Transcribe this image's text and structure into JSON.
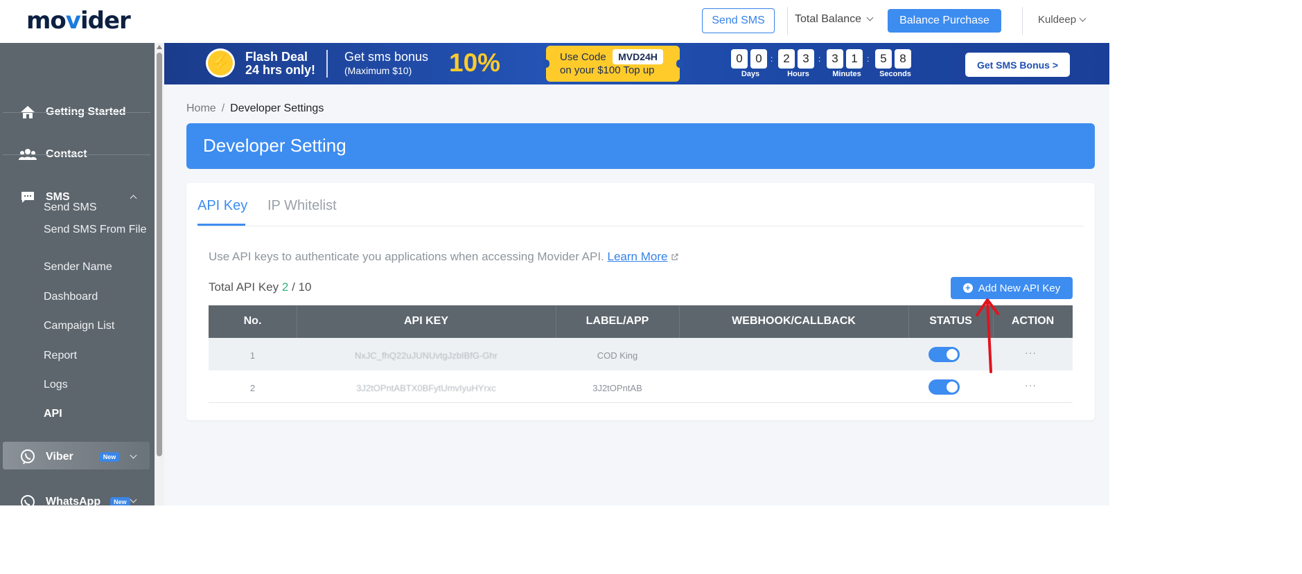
{
  "header": {
    "logo_text_a": "mo",
    "logo_text_v": "v",
    "logo_text_b": "ider",
    "send_sms": "Send SMS",
    "total_balance": "Total Balance",
    "balance_purchase": "Balance Purchase",
    "user": "Kuldeep"
  },
  "sidebar": {
    "items": [
      {
        "label": "Getting Started",
        "icon": "home-icon"
      },
      {
        "label": "Contact",
        "icon": "users-icon"
      },
      {
        "label": "SMS",
        "icon": "message-icon"
      },
      {
        "label": "Viber",
        "icon": "viber-icon",
        "badge": "New"
      },
      {
        "label": "WhatsApp",
        "icon": "whatsapp-icon",
        "badge": "New"
      }
    ],
    "sms_sub": [
      "Send SMS",
      "Send SMS From File",
      "Sender Name",
      "Dashboard",
      "Campaign List",
      "Report",
      "Logs",
      "API"
    ],
    "active": "API"
  },
  "banner": {
    "title_line1": "Flash Deal",
    "title_line2": "24 hrs only!",
    "bonus_line1": "Get sms bonus",
    "bonus_line2": "(Maximum $10)",
    "bonus_pct": "10%",
    "use_code": "Use Code",
    "code": "MVD24H",
    "code_note": "on your $100 Top up",
    "countdown": {
      "days": [
        "0",
        "0"
      ],
      "hours": [
        "2",
        "3"
      ],
      "minutes": [
        "3",
        "1"
      ],
      "seconds": [
        "5",
        "8"
      ],
      "labels": [
        "Days",
        "Hours",
        "Minutes",
        "Seconds"
      ]
    },
    "cta": "Get SMS Bonus >"
  },
  "breadcrumb": {
    "home": "Home",
    "sep": "/",
    "current": "Developer Settings"
  },
  "page_title": "Developer Setting",
  "tabs": [
    {
      "label": "API Key",
      "active": true
    },
    {
      "label": "IP Whitelist",
      "active": false
    }
  ],
  "description": "Use API keys to authenticate you applications when accessing Movider API.",
  "learn_more": "Learn More",
  "total_api_key": {
    "label": "Total API Key",
    "used": "2",
    "sep": "/",
    "max": "10"
  },
  "add_button": "Add New API Key",
  "table": {
    "headers": [
      "No.",
      "API KEY",
      "LABEL/APP",
      "WEBHOOK/CALLBACK",
      "STATUS",
      "ACTION"
    ],
    "rows": [
      {
        "no": "1",
        "api_key": "NxJC_fhQ22uJUNUvtgJzbIBfG-Ghr",
        "label": "COD King",
        "webhook": "",
        "status": true,
        "action": "···"
      },
      {
        "no": "2",
        "api_key": "3J2tOPntABTX0BFytUmvIyuHYrxc",
        "label": "3J2tOPntAB",
        "webhook": "",
        "status": true,
        "action": "···"
      }
    ]
  },
  "colors": {
    "primary": "#3d8cf0",
    "sidebar": "#5d666d",
    "banner": "#2353b5",
    "accent_yellow": "#ffcb2b",
    "annotation_red": "#e0141e"
  }
}
